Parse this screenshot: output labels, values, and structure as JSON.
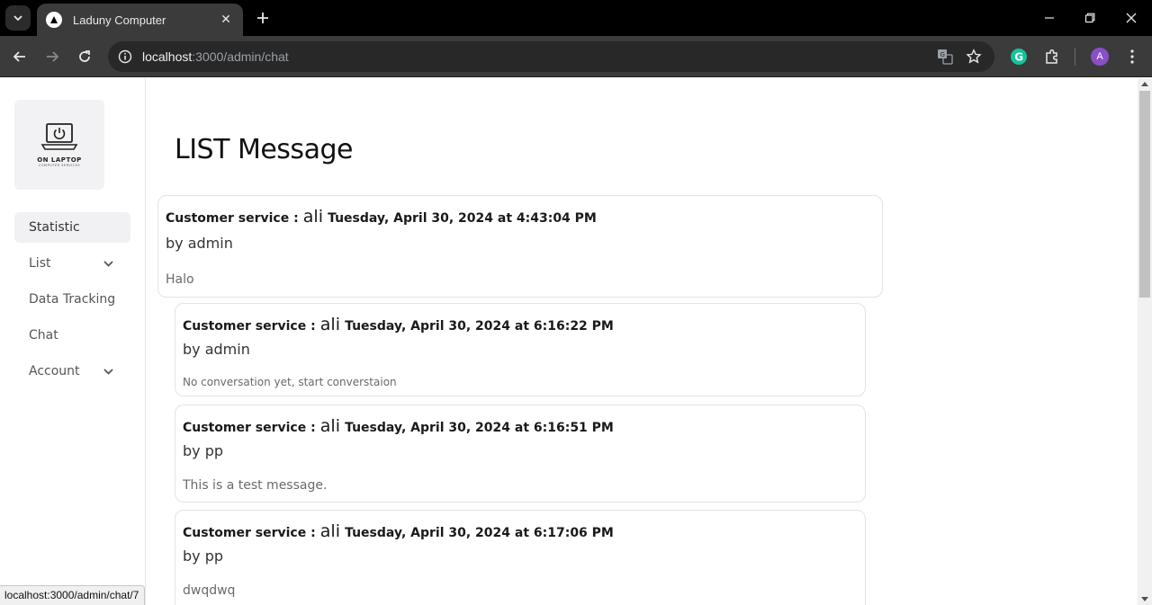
{
  "browser": {
    "tab_title": "Laduny Computer",
    "url_host": "localhost",
    "url_path": ":3000/admin/chat",
    "profile_initial": "A",
    "status_url": "localhost:3000/admin/chat/7"
  },
  "logo": {
    "title": "ON LAPTOP",
    "subtitle": "COMPUTER SERVICES"
  },
  "sidebar": {
    "items": [
      {
        "label": "Statistic",
        "active": true
      },
      {
        "label": "List",
        "expandable": true
      },
      {
        "label": "Data Tracking"
      },
      {
        "label": "Chat"
      },
      {
        "label": "Account",
        "expandable": true
      }
    ]
  },
  "main": {
    "title": "LIST Message",
    "messages": [
      {
        "label": "Customer service :",
        "name": "ali",
        "date": "Tuesday, April 30, 2024 at 4:43:04 PM",
        "by": "by admin",
        "body": "Halo"
      },
      {
        "label": "Customer service :",
        "name": "ali",
        "date": "Tuesday, April 30, 2024 at 6:16:22 PM",
        "by": "by admin",
        "body": "No conversation yet, start converstaion"
      },
      {
        "label": "Customer service :",
        "name": "ali",
        "date": "Tuesday, April 30, 2024 at 6:16:51 PM",
        "by": "by pp",
        "body": "This is a test message."
      },
      {
        "label": "Customer service :",
        "name": "ali",
        "date": "Tuesday, April 30, 2024 at 6:17:06 PM",
        "by": "by pp",
        "body": "dwqdwq"
      }
    ]
  }
}
